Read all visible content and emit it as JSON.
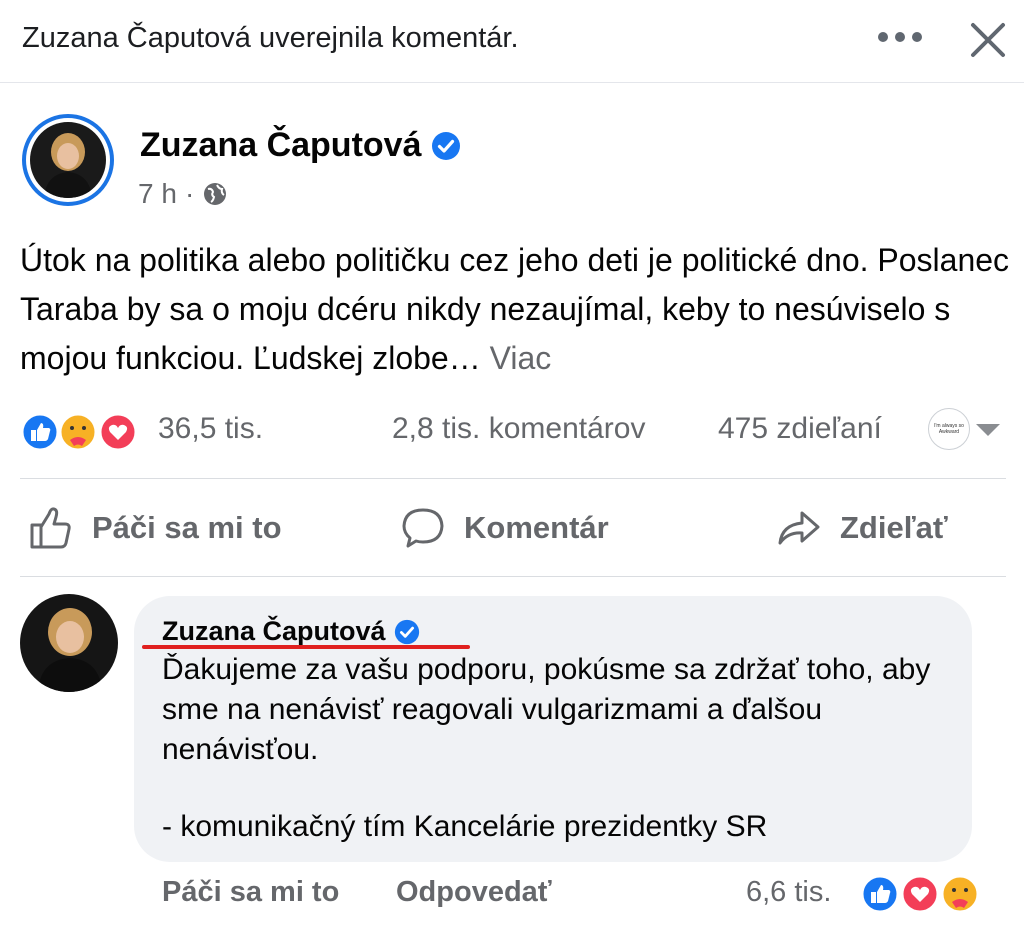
{
  "header": {
    "title": "Zuzana Čaputová uverejnila komentár."
  },
  "post": {
    "author": "Zuzana Čaputová",
    "time": "7 h",
    "separator": "·",
    "text": "Útok na politika alebo političku cez jeho deti je politické dno. Poslanec Taraba by sa o moju dcéru nikdy nezaujímal, keby to nesúviselo s mojou funkciou. Ľudskej zlobe…",
    "more_label": "Viac",
    "reactions_count": "36,5 tis.",
    "comments_count": "2,8 tis. komentárov",
    "shares_count": "475 zdieľaní",
    "viewer_thumb_text": "I'm always so Awkward"
  },
  "actions": {
    "like": "Páči sa mi to",
    "comment": "Komentár",
    "share": "Zdieľať"
  },
  "comment": {
    "author": "Zuzana Čaputová",
    "text": "Ďakujeme za vašu podporu, pokúsme sa zdržať toho, aby sme na nenávisť reagovali vulgarizmami a ďalšou nenávisťou.",
    "signature": "- komunikačný tím Kancelárie prezidentky SR",
    "like_label": "Páči sa mi to",
    "reply_label": "Odpovedať",
    "reactions_count": "6,6 tis."
  },
  "colors": {
    "brand_blue": "#1877f2",
    "love_red": "#f33e58",
    "care_yellow": "#f7b125",
    "highlight_red": "#e0201f"
  }
}
